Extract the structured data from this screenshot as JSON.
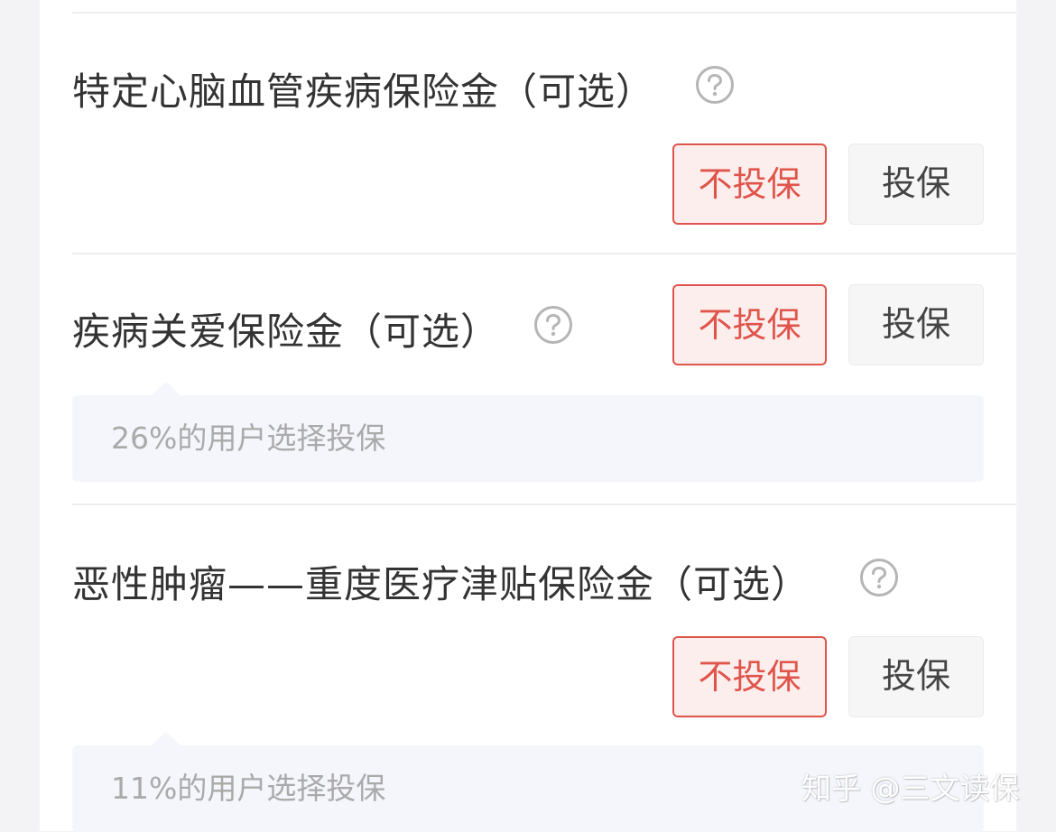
{
  "options": [
    {
      "title": "特定心脑血管疾病保险金（可选）",
      "decline_label": "不投保",
      "accept_label": "投保"
    },
    {
      "title": "疾病关爱保险金（可选）",
      "decline_label": "不投保",
      "accept_label": "投保",
      "tip": "26%的用户选择投保"
    },
    {
      "title": "恶性肿瘤——重度医疗津贴保险金（可选）",
      "decline_label": "不投保",
      "accept_label": "投保",
      "tip": "11%的用户选择投保"
    }
  ],
  "watermark": "知乎 @三文读保",
  "colors": {
    "accent": "#e0554b",
    "accent_bg": "#fdeeee",
    "secondary_bg": "#f6f6f6",
    "tip_bg": "#f5f6fb"
  },
  "icons": {
    "help": "question-circle-icon"
  }
}
